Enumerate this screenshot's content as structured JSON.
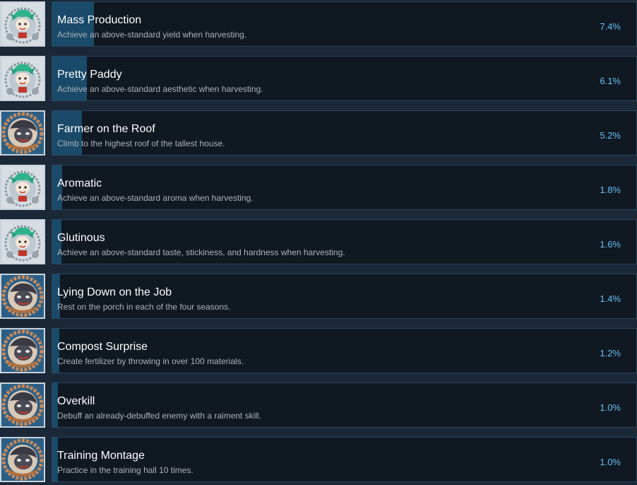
{
  "achievements": [
    {
      "title": "Mass Production",
      "description": "Achieve an above-standard yield when harvesting.",
      "percent_label": "7.4%",
      "percent": 7.4,
      "icon": "green-haired-character-icon"
    },
    {
      "title": "Pretty Paddy",
      "description": "Achieve an above-standard aesthetic when harvesting.",
      "percent_label": "6.1%",
      "percent": 6.1,
      "icon": "green-haired-character-icon"
    },
    {
      "title": "Farmer on the Roof",
      "description": "Climb to the highest roof of the tallest house.",
      "percent_label": "5.2%",
      "percent": 5.2,
      "icon": "dark-creature-face-icon"
    },
    {
      "title": "Aromatic",
      "description": "Achieve an above-standard aroma when harvesting.",
      "percent_label": "1.8%",
      "percent": 1.8,
      "icon": "green-haired-character-icon"
    },
    {
      "title": "Glutinous",
      "description": "Achieve an above-standard taste, stickiness, and hardness when harvesting.",
      "percent_label": "1.6%",
      "percent": 1.6,
      "icon": "green-haired-character-icon"
    },
    {
      "title": "Lying Down on the Job",
      "description": "Rest on the porch in each of the four seasons.",
      "percent_label": "1.4%",
      "percent": 1.4,
      "icon": "dark-creature-face-icon"
    },
    {
      "title": "Compost Surprise",
      "description": "Create fertilizer by throwing in over 100 materials.",
      "percent_label": "1.2%",
      "percent": 1.2,
      "icon": "dark-creature-face-icon"
    },
    {
      "title": "Overkill",
      "description": "Debuff an already-debuffed enemy with a raiment skill.",
      "percent_label": "1.0%",
      "percent": 1.0,
      "icon": "dark-creature-face-icon"
    },
    {
      "title": "Training Montage",
      "description": "Practice in the training hall 10 times.",
      "percent_label": "1.0%",
      "percent": 1.0,
      "icon": "dark-creature-face-icon"
    }
  ],
  "colors": {
    "background": "#1b2838",
    "panel": "#101822",
    "bar": "#1a4a69",
    "title": "#ffffff",
    "description": "#acb2b8",
    "percent": "#66c0f4"
  }
}
